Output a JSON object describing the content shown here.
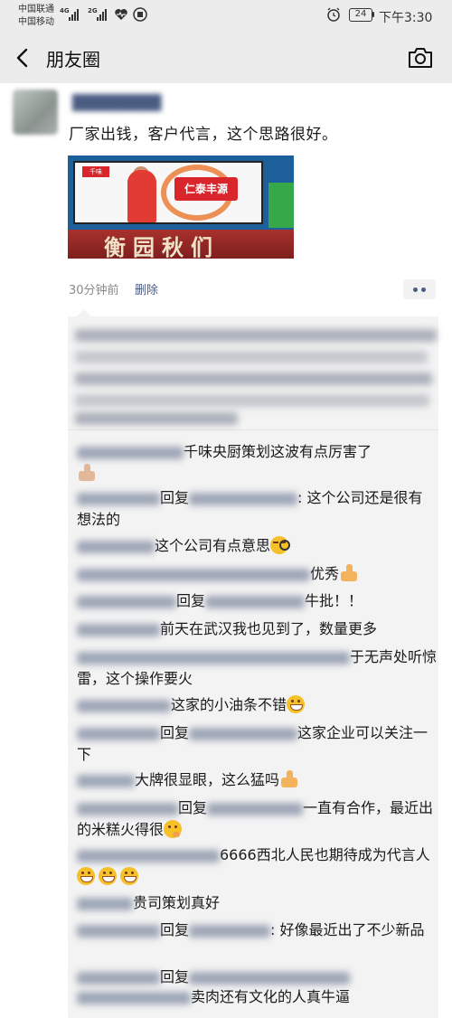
{
  "status_bar": {
    "carrier1": "中国联通",
    "carrier2": "中国移动",
    "net1": "4G",
    "net2": "2G",
    "battery": "24",
    "time": "下午3:30"
  },
  "nav": {
    "title": "朋友圈",
    "back_icon": "chevron-left-icon",
    "camera_icon": "camera-icon"
  },
  "post": {
    "text": "厂家出钱，客户代言，这个思路很好。",
    "image_sign_text": "衡园秋们",
    "image_logo": "千味",
    "image_banner": "仁泰丰源",
    "time": "30分钟前",
    "delete_label": "删除"
  },
  "comments": [
    {
      "text": "千味央厨策划这波有点厉害了",
      "emoji": "thumbs-up"
    },
    {
      "reply": "回复",
      "text": ": 这个公司还是很有想法的"
    },
    {
      "text": "这个公司有点意思",
      "emoji": "squint-face"
    },
    {
      "text": "优秀",
      "emoji": "thumbs-up"
    },
    {
      "reply": "回复",
      "text": "牛批！！"
    },
    {
      "text": "前天在武汉我也见到了，数量更多"
    },
    {
      "text": "于无声处听惊雷，这个操作要火"
    },
    {
      "text": "这家的小油条不错",
      "emoji": "grinning-face"
    },
    {
      "reply": "回复",
      "text": "这家企业可以关注一下"
    },
    {
      "text": "大牌很显眼，这么猛吗",
      "emoji": "thumbs-up"
    },
    {
      "reply": "回复",
      "text": "一直有合作，最近出的米糕火得很",
      "emoji": "thinking-face"
    },
    {
      "text": "6666西北人民也期待成为代言人",
      "emoji": "grinning-face"
    },
    {
      "text": "贵司策划真好"
    },
    {
      "reply": "回复",
      "text": ": 好像最近出了不少新品"
    },
    {
      "reply": "回复",
      "text": ""
    },
    {
      "text": "卖肉还有文化的人真牛逼"
    }
  ]
}
